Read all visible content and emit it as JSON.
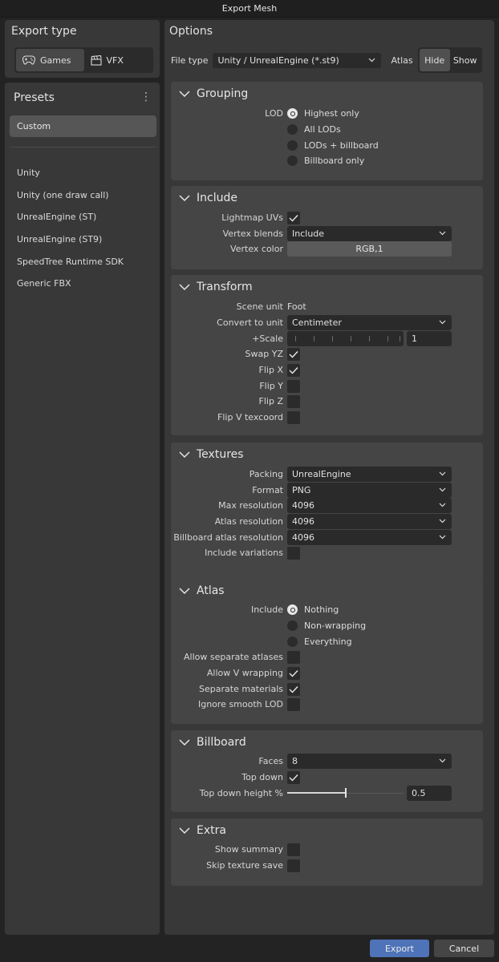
{
  "window": {
    "title": "Export Mesh"
  },
  "export_type": {
    "title": "Export type",
    "options": [
      {
        "label": "Games",
        "icon": "gamepad-icon",
        "selected": true
      },
      {
        "label": "VFX",
        "icon": "clapperboard-icon",
        "selected": false
      }
    ]
  },
  "presets": {
    "title": "Presets",
    "menu_icon": "vertical-dots-icon",
    "selected": "Custom",
    "items": [
      "Unity",
      "Unity (one draw call)",
      "UnrealEngine (ST)",
      "UnrealEngine (ST9)",
      "SpeedTree Runtime SDK",
      "Generic FBX"
    ]
  },
  "options": {
    "title": "Options",
    "file_type_label": "File type",
    "file_type_value": "Unity / UnrealEngine (*.st9)",
    "atlas_label": "Atlas",
    "atlas_hide": "Hide",
    "atlas_show": "Show",
    "atlas_selected": "Hide"
  },
  "grouping": {
    "title": "Grouping",
    "lod_label": "LOD",
    "lod_options": [
      "Highest only",
      "All LODs",
      "LODs + billboard",
      "Billboard only"
    ],
    "lod_selected": 0
  },
  "include": {
    "title": "Include",
    "lightmap_label": "Lightmap UVs",
    "lightmap_checked": true,
    "vertex_blends_label": "Vertex blends",
    "vertex_blends_value": "Include",
    "vertex_color_label": "Vertex color",
    "vertex_color_value": "RGB,1"
  },
  "transform": {
    "title": "Transform",
    "scene_unit_label": "Scene unit",
    "scene_unit_value": "Foot",
    "convert_label": "Convert to unit",
    "convert_value": "Centimeter",
    "scale_label": "+Scale",
    "scale_value": "1",
    "swap_yz_label": "Swap YZ",
    "swap_yz": true,
    "flip_x_label": "Flip X",
    "flip_x": true,
    "flip_y_label": "Flip Y",
    "flip_y": false,
    "flip_z_label": "Flip Z",
    "flip_z": false,
    "flip_v_label": "Flip V texcoord",
    "flip_v": false
  },
  "textures": {
    "title": "Textures",
    "packing_label": "Packing",
    "packing_value": "UnrealEngine",
    "format_label": "Format",
    "format_value": "PNG",
    "max_res_label": "Max resolution",
    "max_res_value": "4096",
    "atlas_res_label": "Atlas resolution",
    "atlas_res_value": "4096",
    "bb_atlas_res_label": "Billboard atlas resolution",
    "bb_atlas_res_value": "4096",
    "variations_label": "Include variations",
    "variations": false
  },
  "atlas": {
    "title": "Atlas",
    "include_label": "Include",
    "include_options": [
      "Nothing",
      "Non-wrapping",
      "Everything"
    ],
    "include_selected": 0,
    "separate_atlases_label": "Allow separate atlases",
    "separate_atlases": false,
    "v_wrapping_label": "Allow V wrapping",
    "v_wrapping": true,
    "separate_materials_label": "Separate materials",
    "separate_materials": true,
    "ignore_smooth_label": "Ignore smooth LOD",
    "ignore_smooth": false
  },
  "billboard": {
    "title": "Billboard",
    "faces_label": "Faces",
    "faces_value": "8",
    "top_down_label": "Top down",
    "top_down": true,
    "top_down_height_label": "Top down height %",
    "top_down_height_value": "0.5",
    "top_down_height_fraction": 0.5
  },
  "extra": {
    "title": "Extra",
    "show_summary_label": "Show summary",
    "show_summary": false,
    "skip_texture_label": "Skip texture save",
    "skip_texture": false
  },
  "footer": {
    "export_label": "Export",
    "cancel_label": "Cancel"
  },
  "colors": {
    "accent": "#4f73b8",
    "panel": "#383838",
    "section": "#454545",
    "field": "#2a2a2a"
  }
}
